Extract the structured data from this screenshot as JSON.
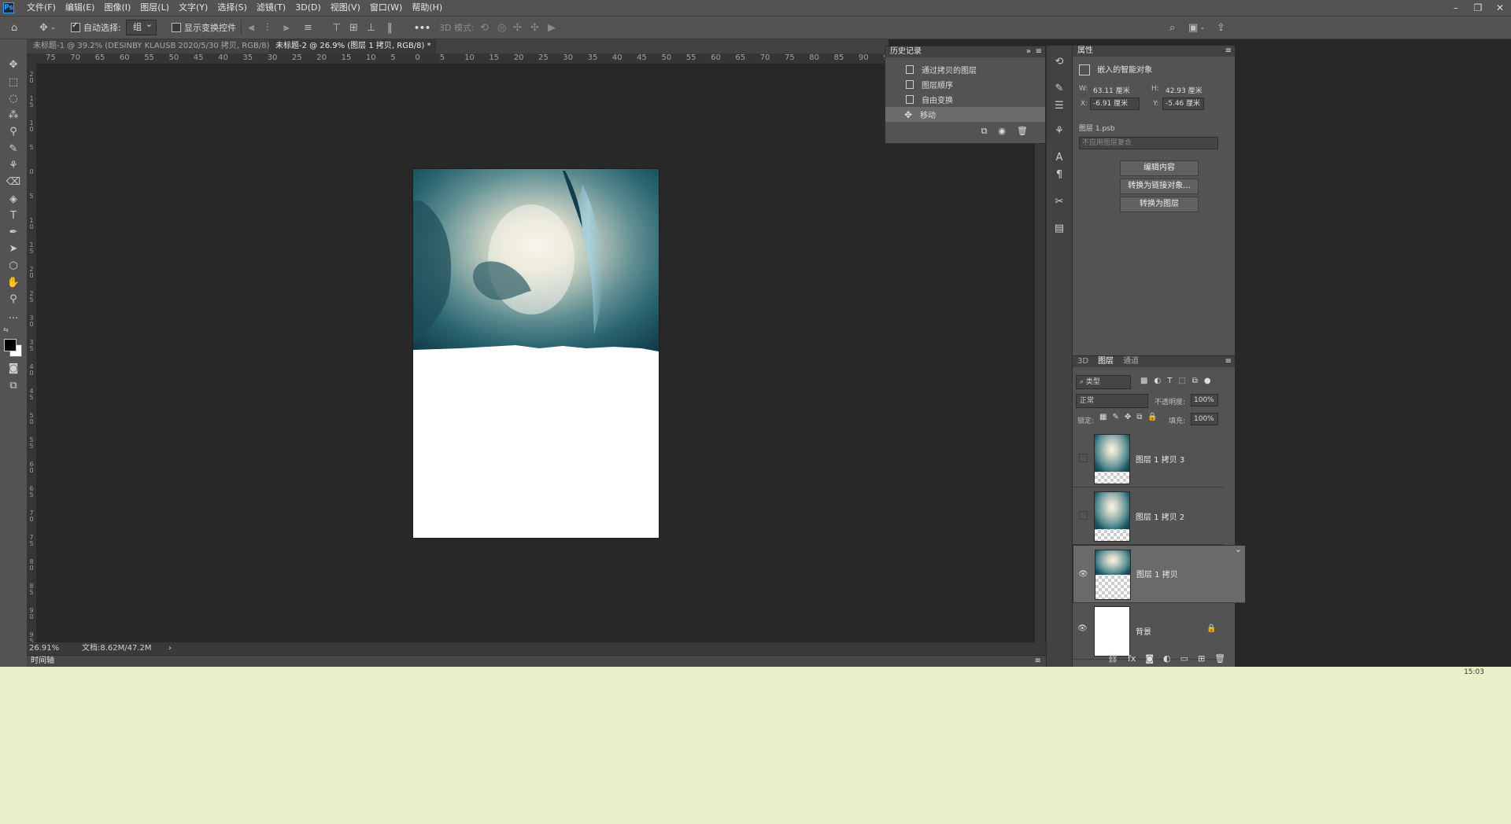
{
  "app": {
    "logo": "Ps"
  },
  "menu": [
    "文件(F)",
    "编辑(E)",
    "图像(I)",
    "图层(L)",
    "文字(Y)",
    "选择(S)",
    "滤镜(T)",
    "3D(D)",
    "视图(V)",
    "窗口(W)",
    "帮助(H)"
  ],
  "options": {
    "auto_select_label": "自动选择:",
    "auto_select_value": "组",
    "show_transform_label": "显示变换控件",
    "mode_3d_label": "3D 模式:",
    "more": "•••"
  },
  "tabs": [
    {
      "label": "未标题-1 @ 39.2% (DESINBY KLAUSB    2020/5/30 拷贝, RGB/8) *",
      "close": "×"
    },
    {
      "label": "未标题-2 @ 26.9% (图层 1 拷贝, RGB/8) *",
      "close": "×"
    }
  ],
  "ruler": {
    "h_ticks": [
      "75",
      "70",
      "65",
      "60",
      "55",
      "50",
      "45",
      "40",
      "35",
      "30",
      "25",
      "20",
      "15",
      "10",
      "5",
      "0",
      "5",
      "10",
      "15",
      "20",
      "25",
      "30",
      "35",
      "40",
      "45",
      "50",
      "55",
      "60",
      "65",
      "70",
      "75",
      "80",
      "85",
      "90",
      "9"
    ],
    "v_ticks": [
      "2 0",
      "1 5",
      "1 0",
      "5",
      "0",
      "5",
      "1 0",
      "1 5",
      "2 0",
      "2 5",
      "3 0",
      "3 5",
      "4 0",
      "4 5",
      "5 0",
      "5 5",
      "6 0",
      "6 5",
      "7 0",
      "7 5",
      "8 0",
      "8 5",
      "9 0",
      "9 5"
    ]
  },
  "status": {
    "zoom": "26.91%",
    "doc": "文档:8.62M/47.2M",
    "arrow": "›"
  },
  "timeline": {
    "label": "时间轴"
  },
  "history": {
    "title": "历史记录",
    "items": [
      "通过拷贝的图层",
      "图层顺序",
      "自由变换",
      "移动"
    ],
    "selected_index": 3
  },
  "properties": {
    "title": "属性",
    "kind": "嵌入的智能对象",
    "w_label": "W:",
    "w_value": "63.11 厘米",
    "h_label": "H:",
    "h_value": "42.93 厘米",
    "x_label": "X:",
    "x_value": "-6.91 厘米",
    "y_label": "Y:",
    "y_value": "-5.46 厘米",
    "file": "图层 1.psb",
    "comp_placeholder": "不应用图层复合",
    "buttons": [
      "编辑内容",
      "转换为链接对象...",
      "转换为图层"
    ]
  },
  "layers_panel": {
    "tabs": [
      "3D",
      "图层",
      "通道"
    ],
    "filter": "类型",
    "blend_mode": "正常",
    "opacity_label": "不透明度:",
    "opacity": "100%",
    "lock_label": "锁定:",
    "fill_label": "填充:",
    "fill": "100%",
    "layers": [
      {
        "name": "图层 1 拷贝 3",
        "visible": false,
        "selected": false
      },
      {
        "name": "图层 1 拷贝 2",
        "visible": false,
        "selected": false
      },
      {
        "name": "图层 1 拷贝",
        "visible": true,
        "selected": true
      },
      {
        "name": "背景",
        "visible": true,
        "selected": false
      }
    ]
  },
  "taskbar": {
    "clock": "15:03"
  }
}
